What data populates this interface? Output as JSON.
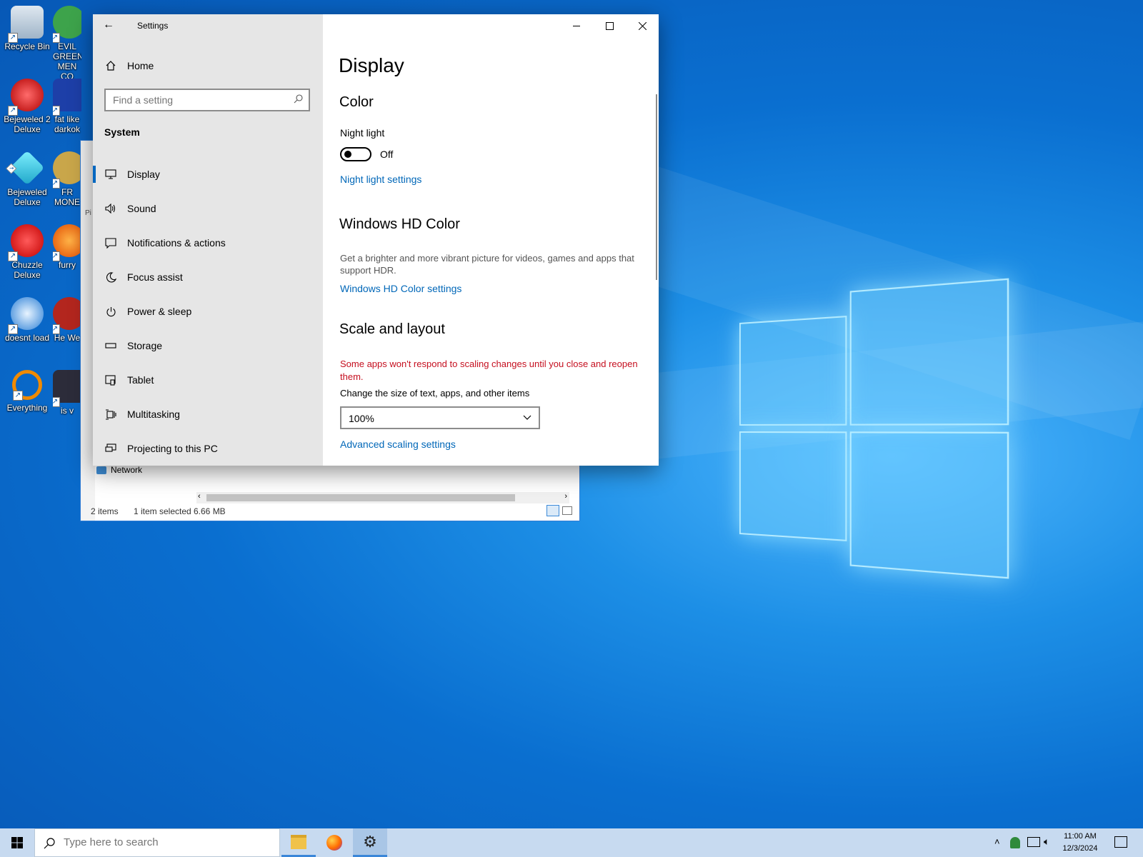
{
  "desktop": {
    "icons": [
      {
        "label": "Recycle Bin",
        "icon": "recycle-bin-icon"
      },
      {
        "label": "EVIL GREEN MEN CO",
        "icon": "green-men-icon"
      },
      {
        "label": "Bejeweled 2 Deluxe",
        "icon": "bejeweled-2-icon"
      },
      {
        "label": "fat like darkok",
        "icon": "game-icon"
      },
      {
        "label": "Bejeweled Deluxe",
        "icon": "diamond-icon"
      },
      {
        "label": "FR MONE",
        "icon": "money-icon"
      },
      {
        "label": "Chuzzle Deluxe",
        "icon": "chuzzle-icon"
      },
      {
        "label": "furry",
        "icon": "firefox-like-icon"
      },
      {
        "label": "doesnt load",
        "icon": "thunderbird-icon"
      },
      {
        "label": "He We",
        "icon": "game-icon"
      },
      {
        "label": "Everything",
        "icon": "magnifier-icon"
      },
      {
        "label": "is v",
        "icon": "game-icon"
      }
    ]
  },
  "explorer": {
    "nav_network": "Network",
    "status_items": "2 items",
    "status_selected": "1 item selected",
    "status_size": "6.66 MB",
    "side_letter": "Pi"
  },
  "settings": {
    "window_title": "Settings",
    "nav": {
      "home": "Home",
      "search_placeholder": "Find a setting",
      "section": "System",
      "items": [
        {
          "label": "Display",
          "icon": "monitor-icon"
        },
        {
          "label": "Sound",
          "icon": "speaker-icon"
        },
        {
          "label": "Notifications & actions",
          "icon": "notification-icon"
        },
        {
          "label": "Focus assist",
          "icon": "moon-icon"
        },
        {
          "label": "Power & sleep",
          "icon": "power-icon"
        },
        {
          "label": "Storage",
          "icon": "storage-icon"
        },
        {
          "label": "Tablet",
          "icon": "tablet-icon"
        },
        {
          "label": "Multitasking",
          "icon": "multitasking-icon"
        },
        {
          "label": "Projecting to this PC",
          "icon": "projecting-icon"
        }
      ]
    },
    "content": {
      "page_title": "Display",
      "color_heading": "Color",
      "night_light_label": "Night light",
      "night_light_state": "Off",
      "night_light_link": "Night light settings",
      "hdr_heading": "Windows HD Color",
      "hdr_description": "Get a brighter and more vibrant picture for videos, games and apps that support HDR.",
      "hdr_link": "Windows HD Color settings",
      "scale_heading": "Scale and layout",
      "scale_warning": "Some apps won't respond to scaling changes until you close and reopen them.",
      "scale_label": "Change the size of text, apps, and other items",
      "scale_value": "100%",
      "advanced_link": "Advanced scaling settings"
    }
  },
  "taskbar": {
    "search_placeholder": "Type here to search",
    "time": "11:00 AM",
    "date": "12/3/2024"
  },
  "colors": {
    "accent": "#0067b8",
    "warning": "#c50f1f",
    "nav_bg": "#e6e6e6"
  }
}
